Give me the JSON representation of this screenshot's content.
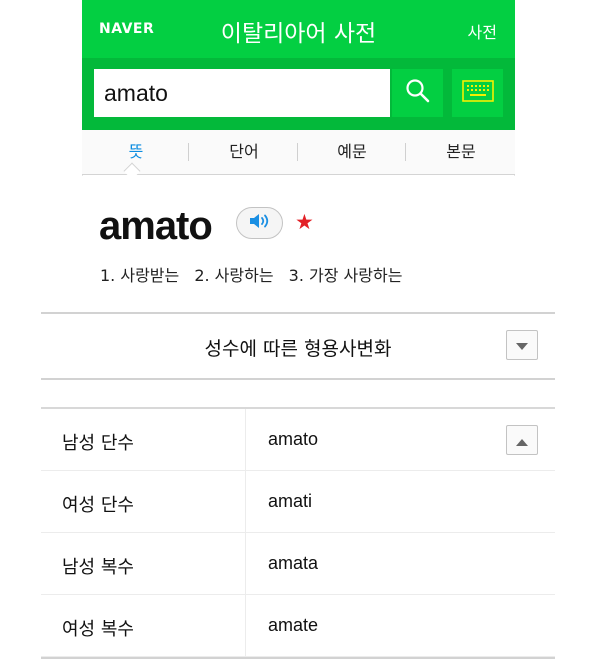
{
  "header": {
    "logo": "NAVER",
    "title": "이탈리아어 사전",
    "dict_link": "사전"
  },
  "search": {
    "value": "amato",
    "search_icon": "search-icon",
    "keyboard_icon": "keyboard-icon"
  },
  "tabs": [
    {
      "label": "뜻",
      "active": true
    },
    {
      "label": "단어",
      "active": false
    },
    {
      "label": "예문",
      "active": false
    },
    {
      "label": "본문",
      "active": false
    }
  ],
  "entry": {
    "headword": "amato",
    "sound_icon": "speaker-icon",
    "star_icon": "star-icon",
    "meanings": [
      "1. 사랑받는",
      "2. 사랑하는",
      "3. 가장 사랑하는"
    ]
  },
  "declension": {
    "title": "성수에 따른 형용사변화",
    "toggle_icon": "chevron-down-icon",
    "collapse_icon": "chevron-up-icon",
    "rows": [
      {
        "label": "남성 단수",
        "value": "amato"
      },
      {
        "label": "여성 단수",
        "value": "amati"
      },
      {
        "label": "남성 복수",
        "value": "amata"
      },
      {
        "label": "여성 복수",
        "value": "amate"
      }
    ]
  },
  "colors": {
    "brand_green": "#03cf42",
    "search_bar_green": "#03b93a",
    "active_tab": "#0b8ce0",
    "star": "#e22127"
  }
}
